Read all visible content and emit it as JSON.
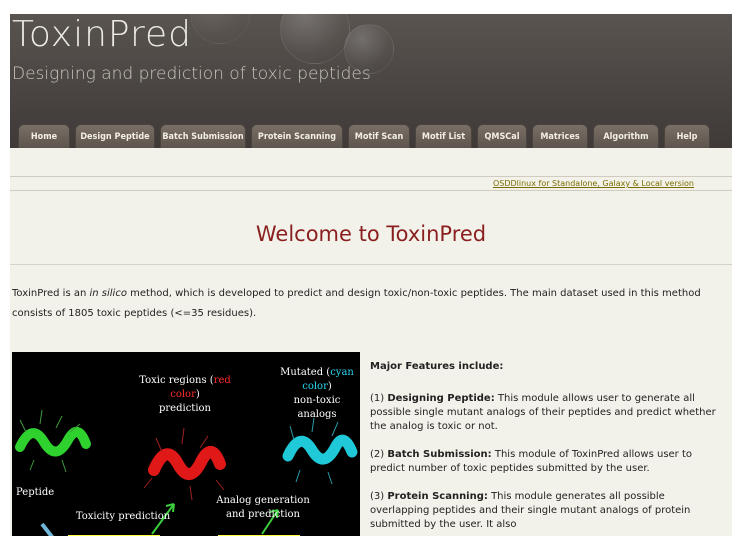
{
  "header": {
    "title": "ToxinPred",
    "tagline": "Designing and prediction of toxic peptides"
  },
  "nav": {
    "tabs": [
      "Home",
      "Design Peptide",
      "Batch Submission",
      "Protein Scanning",
      "Motif Scan",
      "Motif List",
      "QMSCal",
      "Matrices",
      "Algorithm",
      "Help"
    ]
  },
  "osdd_link": "OSDDlinux for Standalone, Galaxy & Local version",
  "welcome": "Welcome to ToxinPred",
  "intro": {
    "before_italic": "ToxinPred is an ",
    "italic": "in silico",
    "after_italic": " method, which is developed to predict and design toxic/non-toxic peptides. The main dataset used in this method consists of 1805 toxic peptides (<=35 residues)."
  },
  "figure": {
    "toxic_regions_prefix": "Toxic regions (",
    "toxic_regions_color": "red color",
    "toxic_regions_suffix": ")",
    "toxic_regions_line2": "prediction",
    "mutated_prefix": "Mutated (",
    "mutated_color": "cyan color",
    "mutated_suffix": ")",
    "mutated_line2": "non-toxic analogs",
    "peptide": "Peptide",
    "toxicity_prediction": "Toxicity prediction",
    "analog_line1": "Analog generation",
    "analog_line2": "and prediction",
    "colors": {
      "helix_green": "#2fd12f",
      "helix_red": "#e01818",
      "helix_cyan": "#20c9d8"
    }
  },
  "features": {
    "heading": "Major Features include:",
    "items": [
      {
        "prefix": "(1) ",
        "title": "Designing Peptide:",
        "text": " This module allows user to generate all possible single mutant analogs of their peptides and predict whether the analog is toxic or not."
      },
      {
        "prefix": "(2) ",
        "title": "Batch Submission:",
        "text": " This module of ToxinPred allows user to predict number of toxic peptides submitted by the user."
      },
      {
        "prefix": "(3) ",
        "title": "Protein Scanning:",
        "text": " This module generates all possible overlapping peptides and their single mutant analogs of protein submitted by the user. It also"
      }
    ]
  }
}
